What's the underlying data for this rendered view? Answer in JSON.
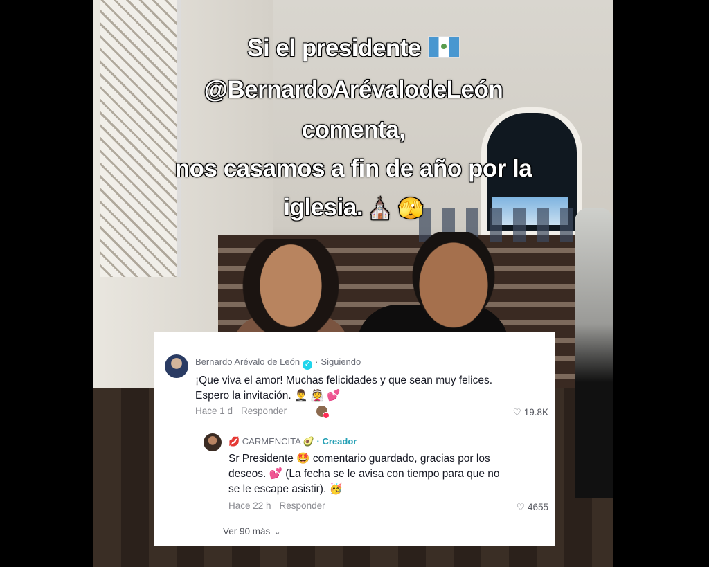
{
  "overlay": {
    "line1": "Si el presidente",
    "line2": "@BernardoArévalodeLeón",
    "line3": "comenta,",
    "line4": "nos casamos a fin de año por la",
    "line5": "iglesia.",
    "line5_emojis": "⛪ 🫣"
  },
  "comment": {
    "author": "Bernardo Arévalo de León",
    "verified_mark": "✓",
    "separator": "·",
    "following": "Siguiendo",
    "text": "¡Que viva el amor! Muchas felicidades y que sean muy felices. Espero la invitación. 🤵‍♂️ 👰 💕",
    "time": "Hace 1 d",
    "reply_label": "Responder",
    "likes": "19.8K"
  },
  "reply": {
    "author": "💋 CARMENCITA 🥑",
    "separator": "·",
    "creator_label": "Creador",
    "text": "Sr Presidente 🤩 comentario guardado, gracias por los deseos. 💕 (La fecha se le avisa con tiempo para que no se le escape asistir). 🥳",
    "time": "Hace 22 h",
    "reply_label": "Responder",
    "likes": "4655"
  },
  "more": {
    "label": "Ver 90 más",
    "chevron": "⌄"
  },
  "icons": {
    "heart": "♡"
  }
}
